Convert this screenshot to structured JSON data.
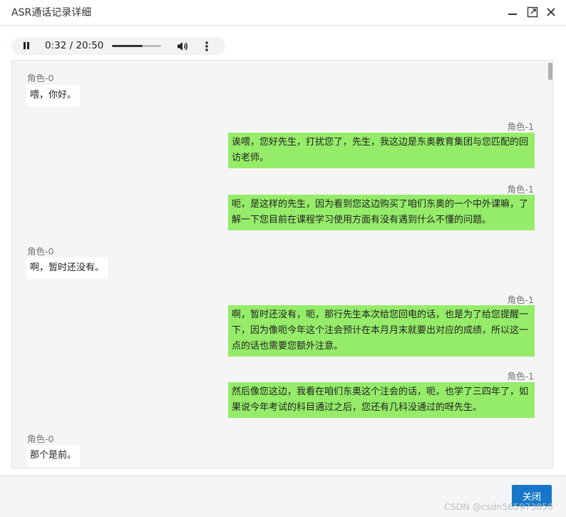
{
  "window": {
    "title": "ASR通话记录详细"
  },
  "audio": {
    "current_time": "0:32",
    "separator": " / ",
    "duration": "20:50",
    "progress_fraction": 0.62
  },
  "messages": [
    {
      "side": "left",
      "role": "角色-0",
      "text": "喂，你好。"
    },
    {
      "side": "right",
      "role": "角色-1",
      "text": "诶喂，您好先生，打扰您了，先生，我这边是东奥教育集团与您匹配的回访老师。"
    },
    {
      "side": "right",
      "role": "角色-1",
      "text": "呃，是这样的先生，因为看到您这边购买了咱们东奥的一个中外课嘛，了解一下您目前在课程学习使用方面有没有遇到什么不懂的问题。"
    },
    {
      "side": "left",
      "role": "角色-0",
      "text": "啊，暂时还没有。"
    },
    {
      "side": "right",
      "role": "角色-1",
      "text": "啊，暂时还没有，呃，那行先生本次给您回电的话，也是为了给您提醒一下，因为像呃今年这个注会预计在本月月末就要出对应的成绩，所以这一点的话也需要您额外注意。"
    },
    {
      "side": "right",
      "role": "角色-1",
      "text": "然后像您这边，我看在咱们东奥这个注会的话，呃，也学了三四年了，如果说今年考试的科目通过之后，您还有几科没通过的呀先生。"
    },
    {
      "side": "left",
      "role": "角色-0",
      "text": "那个是前。"
    }
  ],
  "footer": {
    "close_label": "关闭"
  },
  "watermark": "CSDN @csdn565973850"
}
